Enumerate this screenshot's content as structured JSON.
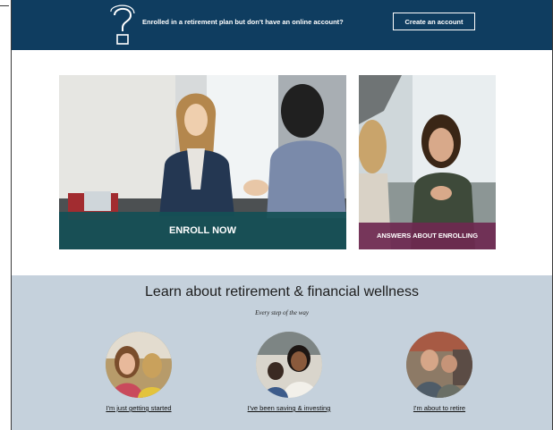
{
  "banner": {
    "message": "Enrolled in a retirement plan but don't have an online account?",
    "button_label": "Create an account",
    "icon": "question-mark-icon",
    "background_color": "#0f3d60"
  },
  "cards": [
    {
      "label": "ENROLL NOW",
      "bar_color": "#145055"
    },
    {
      "label": "ANSWERS ABOUT ENROLLING",
      "bar_color": "#6e2850"
    }
  ],
  "learn": {
    "title": "Learn about retirement & financial wellness",
    "subtitle": "Every step of the way",
    "background_color": "#c5d1dc",
    "personas": [
      {
        "label": "I'm just getting started"
      },
      {
        "label": "I've been saving & investing"
      },
      {
        "label": "I'm about to retire"
      }
    ]
  }
}
